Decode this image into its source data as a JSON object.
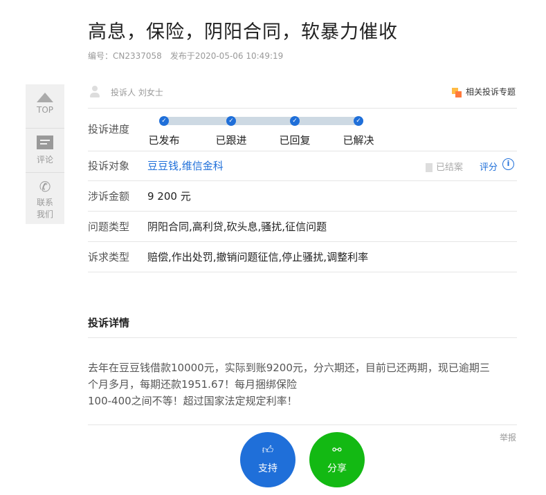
{
  "title": "高息，保险，阴阳合同，软暴力催收",
  "meta": {
    "id": "编号：CN2337058",
    "published": "发布于2020-05-06 10:49:19"
  },
  "sidebar": {
    "top": "TOP",
    "comment": "评论",
    "contact": "联系\n我们",
    "contact1": "联系",
    "contact2": "我们"
  },
  "complainant": "投诉人 刘女士",
  "related": "相关投诉专题",
  "progress": {
    "label": "投诉进度",
    "steps": [
      "已发布",
      "已跟进",
      "已回复",
      "已解决"
    ]
  },
  "target": {
    "label": "投诉对象",
    "value": "豆豆钱,维信金科",
    "status": "已结案",
    "rate": "评分"
  },
  "amount": {
    "label": "涉诉金额",
    "value": "9 200 元"
  },
  "issue": {
    "label": "问题类型",
    "value": "阴阳合同,高利贷,砍头息,骚扰,征信问题"
  },
  "demand": {
    "label": "诉求类型",
    "value": "赔偿,作出处罚,撤销问题征信,停止骚扰,调整利率"
  },
  "detail": {
    "heading": "投诉详情",
    "lines": [
      "去年在豆豆钱借款10000元，实际到账9200元，分六期还，目前已还两期，现已逾期三",
      "个月多月，每期还款1951.67！每月捆绑保险",
      "100-400之间不等！超过国家法定规定利率！"
    ]
  },
  "report": "举报",
  "support": "支持",
  "share": "分享",
  "colors": {
    "blue": "#1f6fd9",
    "green": "#13b913"
  }
}
